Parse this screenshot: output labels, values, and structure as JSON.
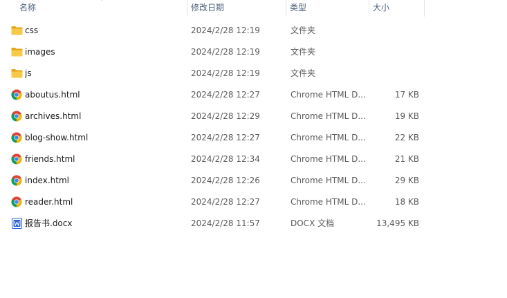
{
  "columns": {
    "name": "名称",
    "date": "修改日期",
    "type": "类型",
    "size": "大小"
  },
  "files": [
    {
      "name": "css",
      "date": "2024/2/28 12:19",
      "type": "文件夹",
      "size": "",
      "icon": "folder-icon"
    },
    {
      "name": "images",
      "date": "2024/2/28 12:19",
      "type": "文件夹",
      "size": "",
      "icon": "folder-icon"
    },
    {
      "name": "js",
      "date": "2024/2/28 12:19",
      "type": "文件夹",
      "size": "",
      "icon": "folder-icon"
    },
    {
      "name": "aboutus.html",
      "date": "2024/2/28 12:27",
      "type": "Chrome HTML D...",
      "size": "17 KB",
      "icon": "chrome-icon"
    },
    {
      "name": "archives.html",
      "date": "2024/2/28 12:29",
      "type": "Chrome HTML D...",
      "size": "19 KB",
      "icon": "chrome-icon"
    },
    {
      "name": "blog-show.html",
      "date": "2024/2/28 12:27",
      "type": "Chrome HTML D...",
      "size": "22 KB",
      "icon": "chrome-icon"
    },
    {
      "name": "friends.html",
      "date": "2024/2/28 12:34",
      "type": "Chrome HTML D...",
      "size": "21 KB",
      "icon": "chrome-icon"
    },
    {
      "name": "index.html",
      "date": "2024/2/28 12:26",
      "type": "Chrome HTML D...",
      "size": "29 KB",
      "icon": "chrome-icon"
    },
    {
      "name": "reader.html",
      "date": "2024/2/28 12:27",
      "type": "Chrome HTML D...",
      "size": "18 KB",
      "icon": "chrome-icon"
    },
    {
      "name": "报告书.docx",
      "date": "2024/2/28 11:57",
      "type": "DOCX 文档",
      "size": "13,495 KB",
      "icon": "docx-icon"
    }
  ],
  "colors": {
    "folder": "#f7c948",
    "header_text": "#4c607a",
    "docx": "#2b62d9"
  }
}
